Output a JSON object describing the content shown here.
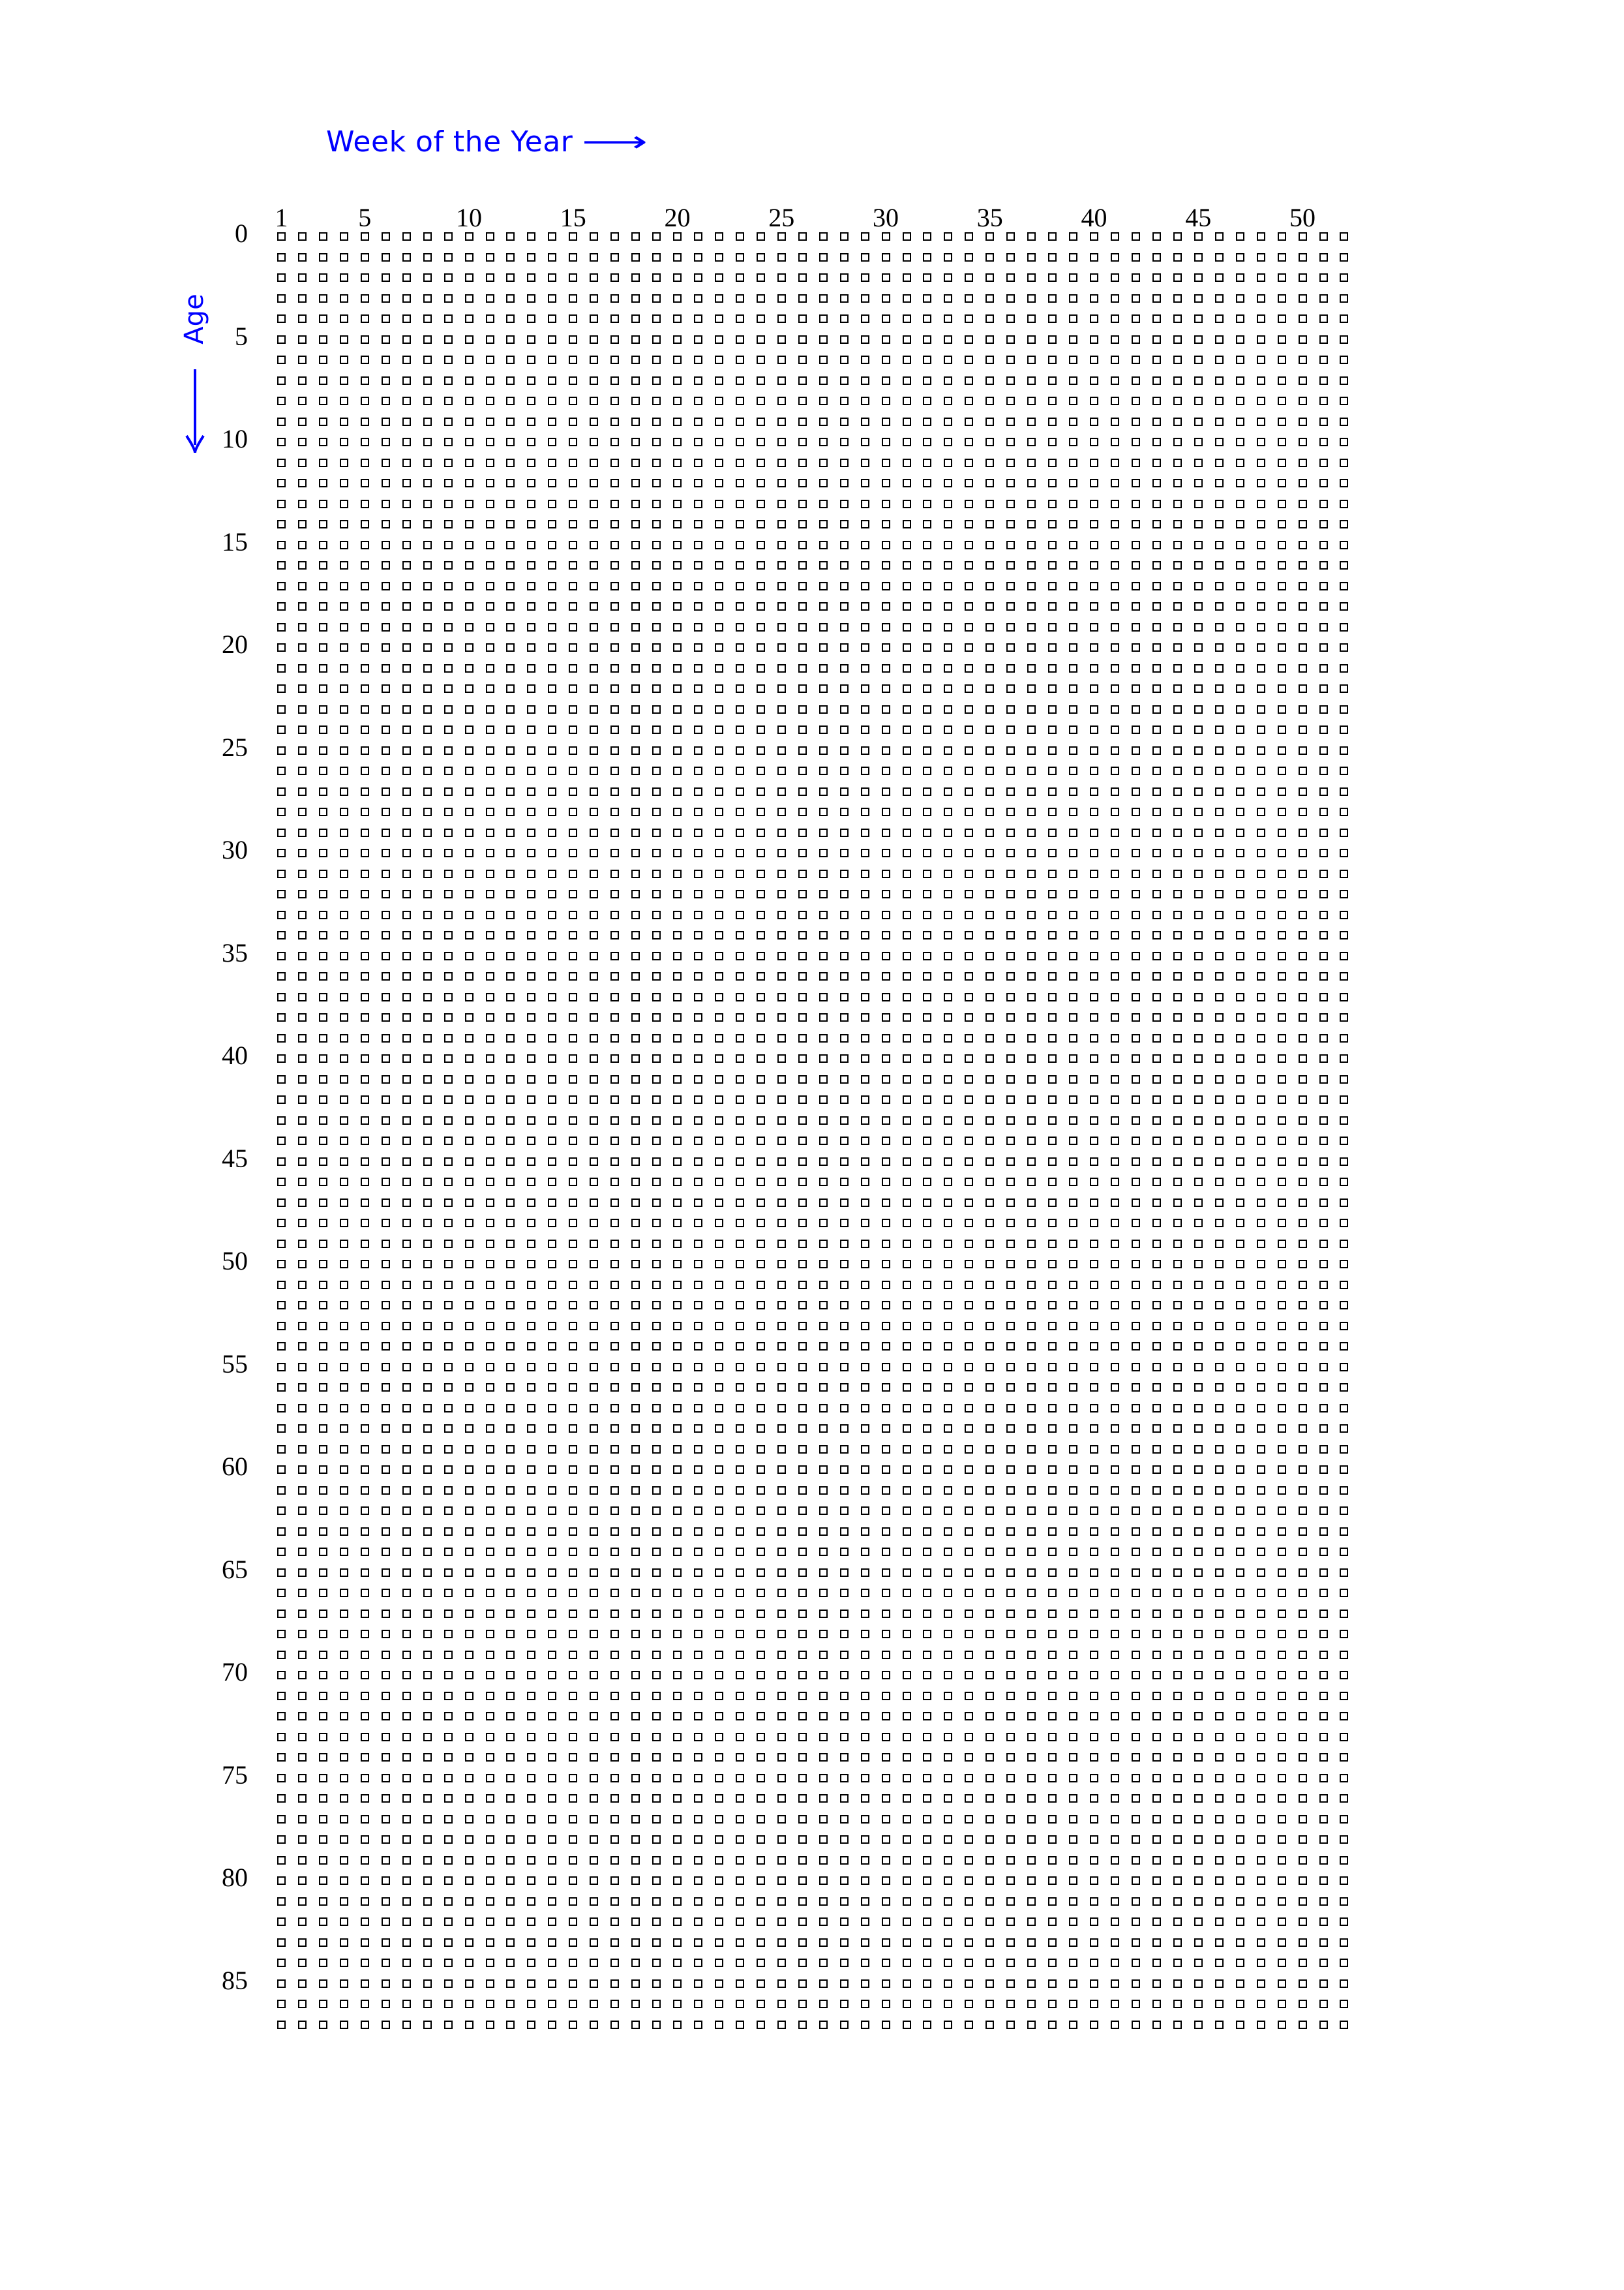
{
  "figure": {
    "background_color": "#ffffff",
    "accent_color": "#0000ff",
    "cell_color": "#000000"
  },
  "axes": {
    "x_title": "Week of the Year",
    "x_title_arrow": "⟶",
    "y_title": "Age",
    "y_title_arrow": "↓"
  },
  "chart_data": {
    "type": "heatmap",
    "title": "",
    "subtitle": "",
    "xlabel": "Week of the Year",
    "ylabel": "Age",
    "description": "Life-in-weeks calendar grid: each small empty square is one week of life. Columns are the 52 weeks of a year, rows are years of age from 0 through 87. All squares are unfilled (empty outline), so every cell value is 0.",
    "legend": [],
    "legend_position": "none",
    "grid": false,
    "x": [
      1,
      2,
      3,
      4,
      5,
      6,
      7,
      8,
      9,
      10,
      11,
      12,
      13,
      14,
      15,
      16,
      17,
      18,
      19,
      20,
      21,
      22,
      23,
      24,
      25,
      26,
      27,
      28,
      29,
      30,
      31,
      32,
      33,
      34,
      35,
      36,
      37,
      38,
      39,
      40,
      41,
      42,
      43,
      44,
      45,
      46,
      47,
      48,
      49,
      50,
      51,
      52
    ],
    "y": [
      0,
      1,
      2,
      3,
      4,
      5,
      6,
      7,
      8,
      9,
      10,
      11,
      12,
      13,
      14,
      15,
      16,
      17,
      18,
      19,
      20,
      21,
      22,
      23,
      24,
      25,
      26,
      27,
      28,
      29,
      30,
      31,
      32,
      33,
      34,
      35,
      36,
      37,
      38,
      39,
      40,
      41,
      42,
      43,
      44,
      45,
      46,
      47,
      48,
      49,
      50,
      51,
      52,
      53,
      54,
      55,
      56,
      57,
      58,
      59,
      60,
      61,
      62,
      63,
      64,
      65,
      66,
      67,
      68,
      69,
      70,
      71,
      72,
      73,
      74,
      75,
      76,
      77,
      78,
      79,
      80,
      81,
      82,
      83,
      84,
      85,
      86,
      87
    ],
    "xlim": [
      1,
      52
    ],
    "ylim": [
      0,
      87
    ],
    "n_columns": 52,
    "n_rows": 88,
    "total_cells": 4576,
    "filled_cells": 0,
    "cell_marker": "empty-square",
    "xticks": [
      1,
      5,
      10,
      15,
      20,
      25,
      30,
      35,
      40,
      45,
      50
    ],
    "xticklabels": [
      "1",
      "5",
      "10",
      "15",
      "20",
      "25",
      "30",
      "35",
      "40",
      "45",
      "50"
    ],
    "yticks": [
      0,
      5,
      10,
      15,
      20,
      25,
      30,
      35,
      40,
      45,
      50,
      55,
      60,
      65,
      70,
      75,
      80,
      85
    ],
    "yticklabels": [
      "0",
      "5",
      "10",
      "15",
      "20",
      "25",
      "30",
      "35",
      "40",
      "45",
      "50",
      "55",
      "60",
      "65",
      "70",
      "75",
      "80",
      "85"
    ],
    "values": []
  },
  "layout": {
    "grid_origin_x": 425,
    "grid_origin_y": 356,
    "col_step": 31.95,
    "row_step": 31.5,
    "cell_size": 13
  }
}
